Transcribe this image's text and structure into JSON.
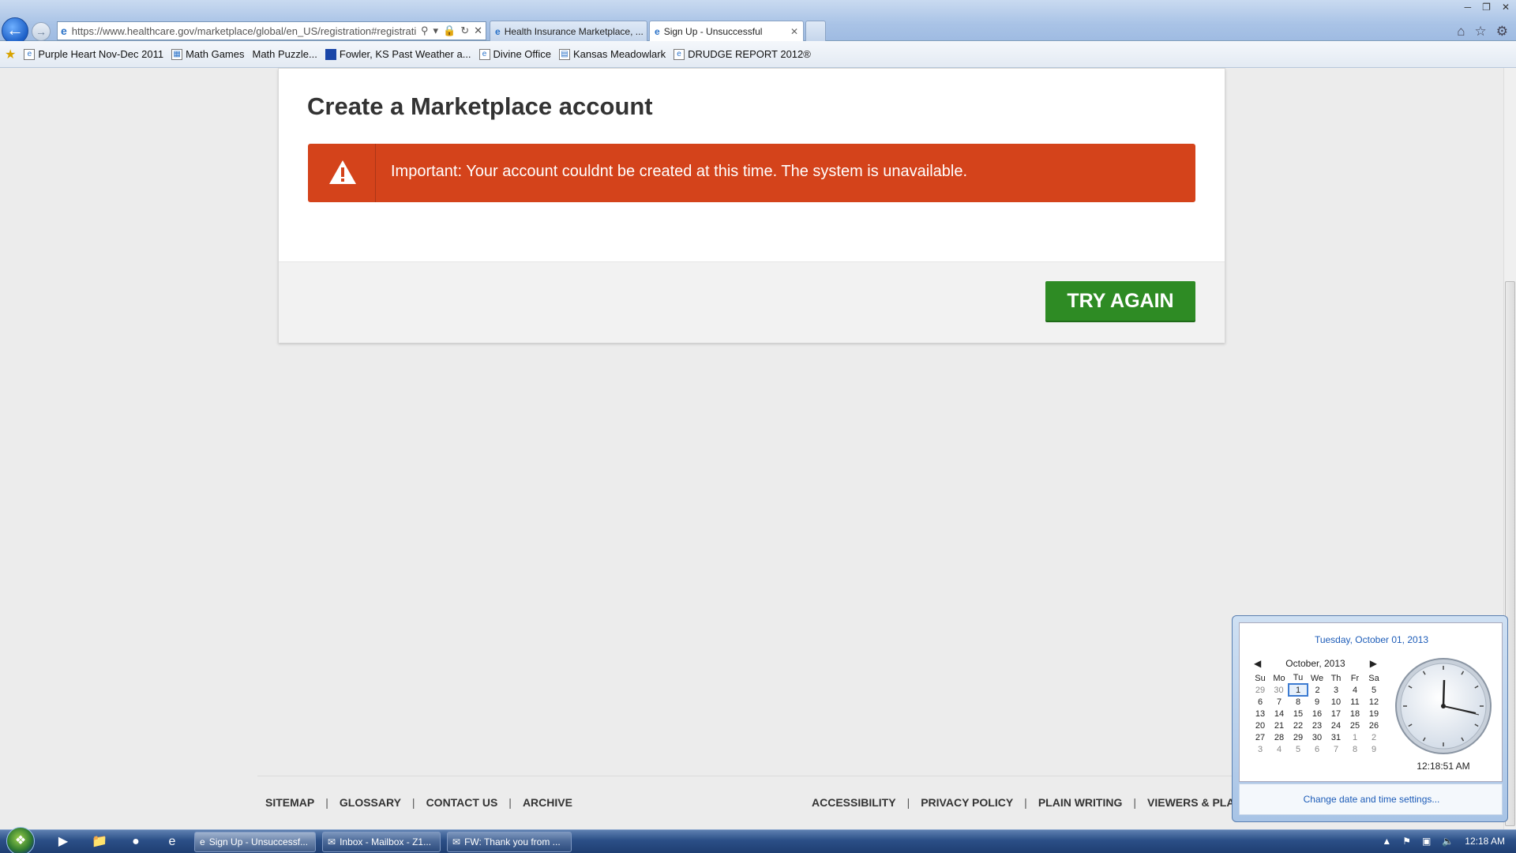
{
  "browser": {
    "url": "https://www.healthcare.gov/marketplace/global/en_US/registration#registrationS",
    "tabs": [
      {
        "label": "Health Insurance Marketplace, ..."
      },
      {
        "label": "Sign Up - Unsuccessful"
      }
    ],
    "favorites": [
      {
        "label": "Purple Heart Nov-Dec 2011"
      },
      {
        "label": "Math Games"
      },
      {
        "label": "Math Puzzle..."
      },
      {
        "label": "Fowler, KS Past Weather a..."
      },
      {
        "label": "Divine Office"
      },
      {
        "label": "Kansas Meadowlark"
      },
      {
        "label": "DRUDGE REPORT 2012®"
      }
    ]
  },
  "page": {
    "title": "Create a Marketplace account",
    "alert_text": "Important: Your account couldnt be created at this time. The system is unavailable.",
    "alert_color": "#d4431b",
    "try_again_label": "TRY AGAIN",
    "button_color": "#2e8b24"
  },
  "footer": {
    "left_links": [
      "SITEMAP",
      "GLOSSARY",
      "CONTACT US",
      "ARCHIVE"
    ],
    "right_links": [
      "ACCESSIBILITY",
      "PRIVACY POLICY",
      "PLAIN WRITING",
      "VIEWERS & PLAYERS"
    ]
  },
  "clock_popup": {
    "full_date": "Tuesday, October 01, 2013",
    "month_label": "October, 2013",
    "weekdays": [
      "Su",
      "Mo",
      "Tu",
      "We",
      "Th",
      "Fr",
      "Sa"
    ],
    "weeks": [
      [
        "29",
        "30",
        "1",
        "2",
        "3",
        "4",
        "5"
      ],
      [
        "6",
        "7",
        "8",
        "9",
        "10",
        "11",
        "12"
      ],
      [
        "13",
        "14",
        "15",
        "16",
        "17",
        "18",
        "19"
      ],
      [
        "20",
        "21",
        "22",
        "23",
        "24",
        "25",
        "26"
      ],
      [
        "27",
        "28",
        "29",
        "30",
        "31",
        "1",
        "2"
      ],
      [
        "3",
        "4",
        "5",
        "6",
        "7",
        "8",
        "9"
      ]
    ],
    "time": "12:18:51 AM",
    "change_settings": "Change date and time settings..."
  },
  "taskbar": {
    "tasks": [
      {
        "label": "Sign Up - Unsuccessf..."
      },
      {
        "label": "Inbox - Mailbox - Z1..."
      },
      {
        "label": "FW: Thank you from ..."
      }
    ],
    "clock": "12:18 AM"
  }
}
